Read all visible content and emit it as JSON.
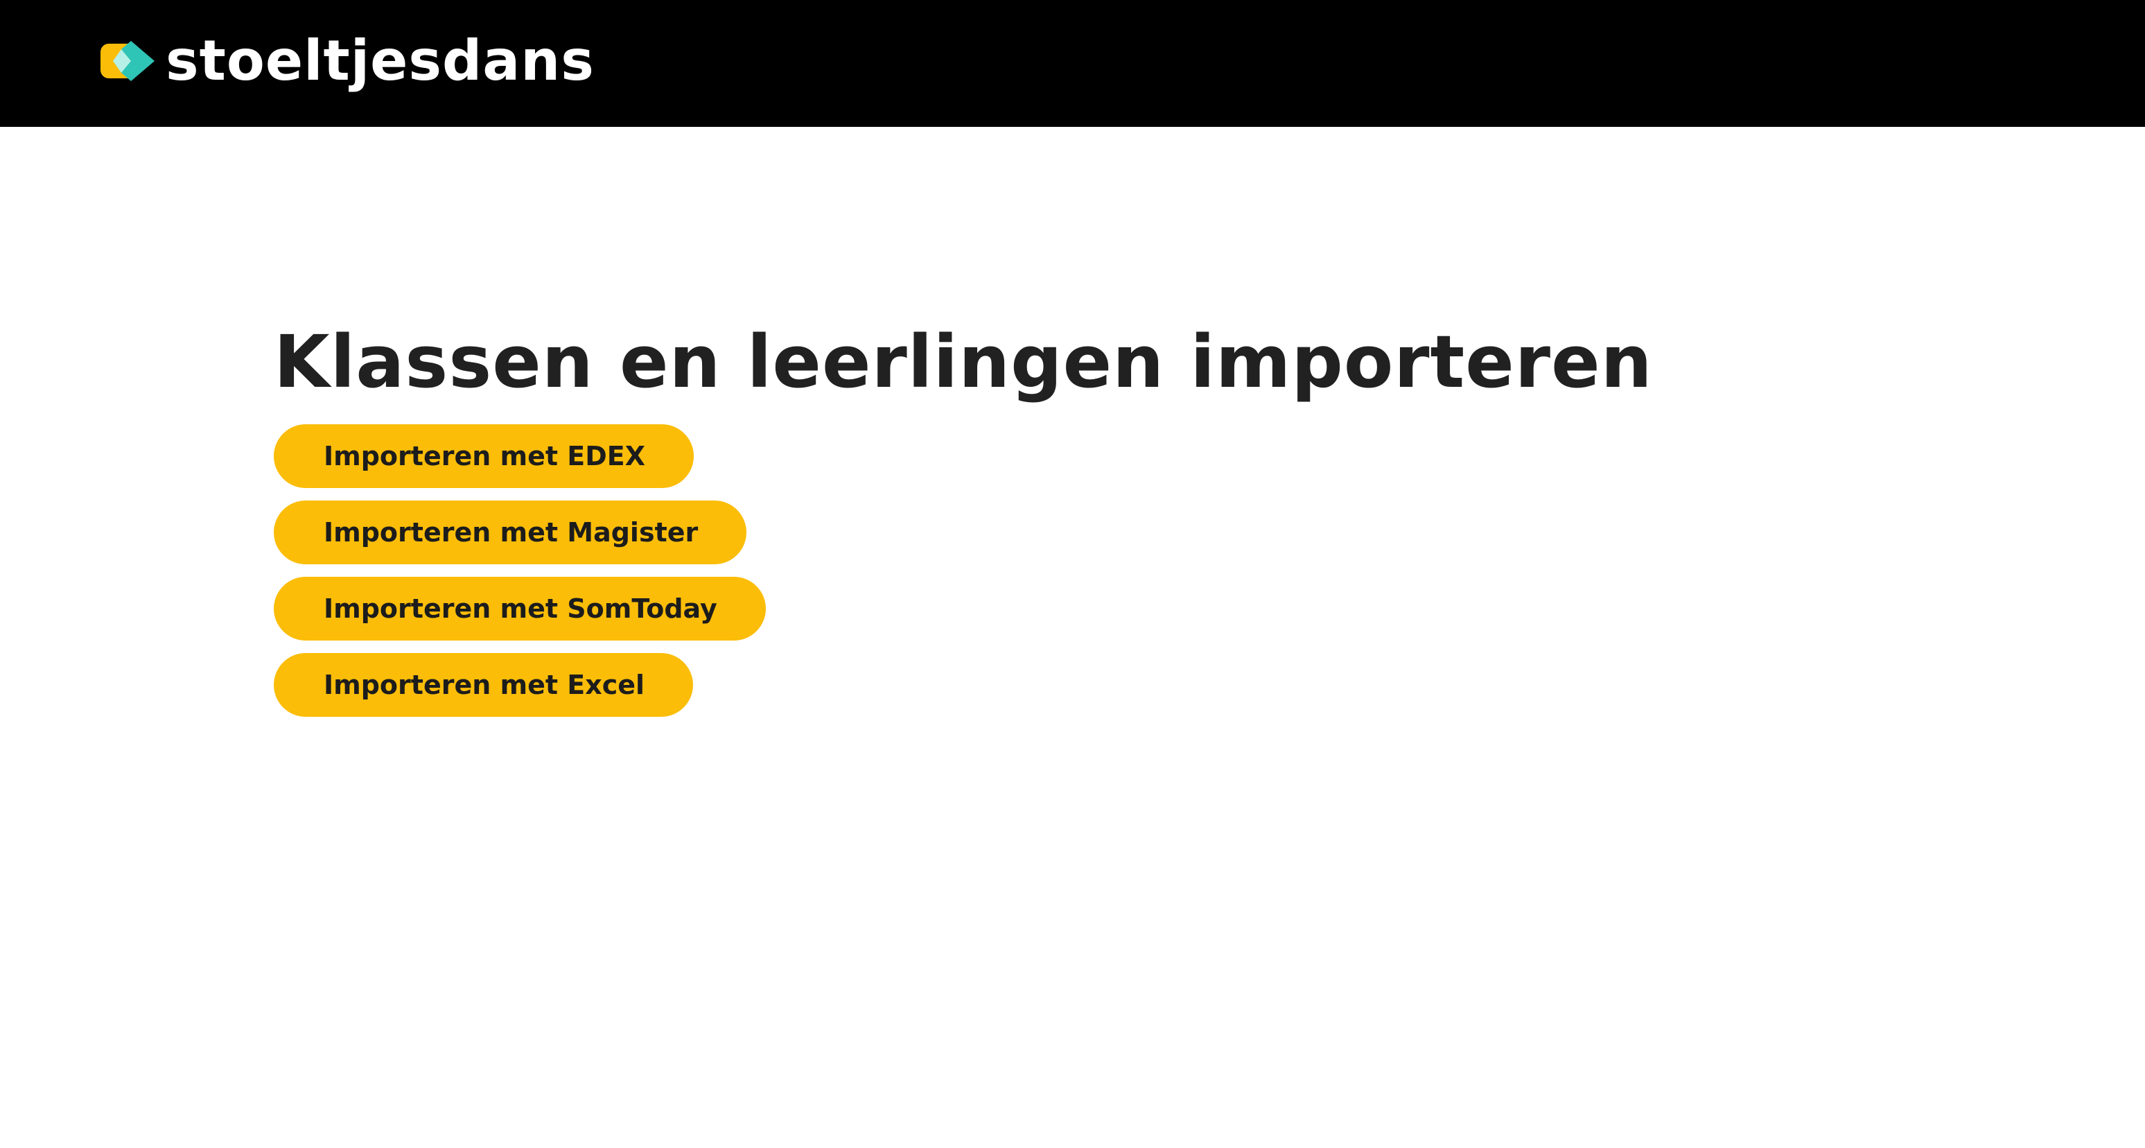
{
  "header": {
    "brand_name": "stoeltjesdans",
    "logo_icon": "stoeltjesdans-logo-icon",
    "background_color": "#000000",
    "logo_colors": {
      "yellow": "#fbbd08",
      "teal": "#2ec4b6",
      "mint": "#b6f0e6"
    }
  },
  "main": {
    "title": "Klassen en leerlingen importeren",
    "buttons": [
      {
        "label": "Importeren met EDEX"
      },
      {
        "label": "Importeren met Magister"
      },
      {
        "label": "Importeren met SomToday"
      },
      {
        "label": "Importeren met Excel"
      }
    ],
    "button_color": "#fbbd08"
  }
}
